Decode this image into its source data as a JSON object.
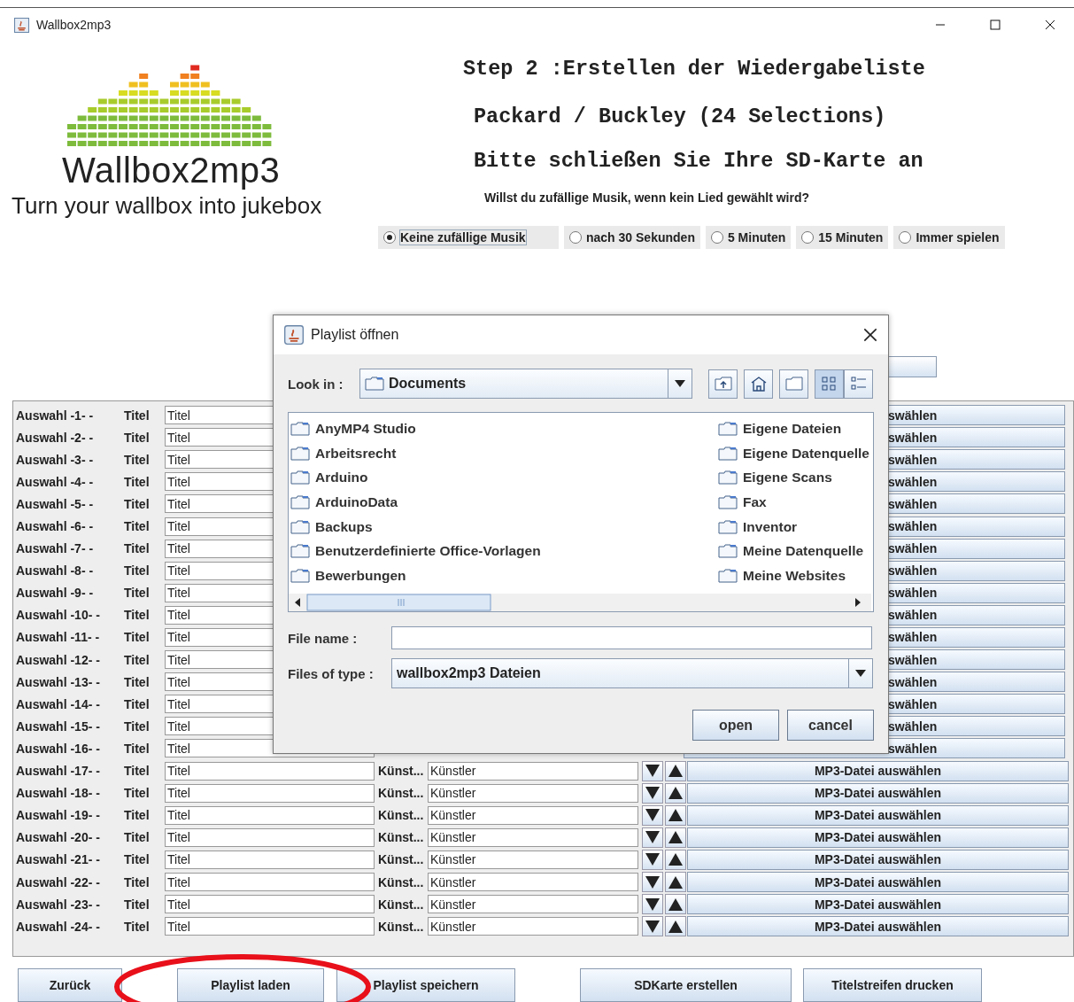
{
  "window": {
    "title": "Wallbox2mp3"
  },
  "logo": {
    "name": "Wallbox2mp3",
    "tagline": "Turn your wallbox into jukebox"
  },
  "headings": [
    "Step 2 :Erstellen der Wiedergabeliste",
    "Packard / Buckley (24 Selections)",
    "Bitte schließen Sie Ihre SD-Karte an"
  ],
  "random_question": "Willst du zufällige Musik, wenn kein Lied gewählt wird?",
  "random_options": [
    {
      "label": "Keine zufällige Musik",
      "selected": true
    },
    {
      "label": "nach 30 Sekunden",
      "selected": false
    },
    {
      "label": "5 Minuten",
      "selected": false
    },
    {
      "label": "15 Minuten",
      "selected": false
    },
    {
      "label": "Immer spielen",
      "selected": false
    }
  ],
  "rows": [
    {
      "kind": "covered",
      "label": "Auswahl -1- -",
      "title_label": "Titel",
      "title": "Titel",
      "button": "swählen"
    },
    {
      "kind": "covered",
      "label": "Auswahl -2- -",
      "title_label": "Titel",
      "title": "Titel",
      "button": "swählen"
    },
    {
      "kind": "covered",
      "label": "Auswahl -3- -",
      "title_label": "Titel",
      "title": "Titel",
      "button": "swählen"
    },
    {
      "kind": "covered",
      "label": "Auswahl -4- -",
      "title_label": "Titel",
      "title": "Titel",
      "button": "swählen"
    },
    {
      "kind": "covered",
      "label": "Auswahl -5- -",
      "title_label": "Titel",
      "title": "Titel",
      "button": "swählen"
    },
    {
      "kind": "covered",
      "label": "Auswahl -6- -",
      "title_label": "Titel",
      "title": "Titel",
      "button": "swählen"
    },
    {
      "kind": "covered",
      "label": "Auswahl -7- -",
      "title_label": "Titel",
      "title": "Titel",
      "button": "swählen"
    },
    {
      "kind": "covered",
      "label": "Auswahl -8- -",
      "title_label": "Titel",
      "title": "Titel",
      "button": "swählen"
    },
    {
      "kind": "covered",
      "label": "Auswahl -9- -",
      "title_label": "Titel",
      "title": "Titel",
      "button": "swählen"
    },
    {
      "kind": "covered",
      "label": "Auswahl -10- -",
      "title_label": "Titel",
      "title": "Titel",
      "button": "swählen"
    },
    {
      "kind": "covered",
      "label": "Auswahl -11- -",
      "title_label": "Titel",
      "title": "Titel",
      "button": "swählen"
    },
    {
      "kind": "covered",
      "label": "Auswahl -12- -",
      "title_label": "Titel",
      "title": "Titel",
      "button": "swählen"
    },
    {
      "kind": "covered",
      "label": "Auswahl -13- -",
      "title_label": "Titel",
      "title": "Titel",
      "button": "swählen"
    },
    {
      "kind": "covered",
      "label": "Auswahl -14- -",
      "title_label": "Titel",
      "title": "Titel",
      "button": "swählen"
    },
    {
      "kind": "covered",
      "label": "Auswahl -15- -",
      "title_label": "Titel",
      "title": "Titel",
      "button": "swählen"
    },
    {
      "kind": "covered",
      "label": "Auswahl -16- -",
      "title_label": "Titel",
      "title": "Titel",
      "button": "swählen"
    },
    {
      "kind": "full",
      "label": "Auswahl -17- -",
      "title_label": "Titel",
      "title": "Titel",
      "artist_label": "Künst...",
      "artist": "Künstler",
      "button": "MP3-Datei auswählen"
    },
    {
      "kind": "full",
      "label": "Auswahl -18- -",
      "title_label": "Titel",
      "title": "Titel",
      "artist_label": "Künst...",
      "artist": "Künstler",
      "button": "MP3-Datei auswählen"
    },
    {
      "kind": "full",
      "label": "Auswahl -19- -",
      "title_label": "Titel",
      "title": "Titel",
      "artist_label": "Künst...",
      "artist": "Künstler",
      "button": "MP3-Datei auswählen"
    },
    {
      "kind": "full",
      "label": "Auswahl -20- -",
      "title_label": "Titel",
      "title": "Titel",
      "artist_label": "Künst...",
      "artist": "Künstler",
      "button": "MP3-Datei auswählen"
    },
    {
      "kind": "full",
      "label": "Auswahl -21- -",
      "title_label": "Titel",
      "title": "Titel",
      "artist_label": "Künst...",
      "artist": "Künstler",
      "button": "MP3-Datei auswählen"
    },
    {
      "kind": "full",
      "label": "Auswahl -22- -",
      "title_label": "Titel",
      "title": "Titel",
      "artist_label": "Künst...",
      "artist": "Künstler",
      "button": "MP3-Datei auswählen"
    },
    {
      "kind": "full",
      "label": "Auswahl -23- -",
      "title_label": "Titel",
      "title": "Titel",
      "artist_label": "Künst...",
      "artist": "Künstler",
      "button": "MP3-Datei auswählen"
    },
    {
      "kind": "full",
      "label": "Auswahl -24- -",
      "title_label": "Titel",
      "title": "Titel",
      "artist_label": "Künst...",
      "artist": "Künstler",
      "button": "MP3-Datei auswählen"
    }
  ],
  "bottom_buttons": [
    {
      "label": "Zurück",
      "highlighted": false
    },
    {
      "label": "Playlist laden",
      "highlighted": true
    },
    {
      "label": "Playlist speichern",
      "highlighted": false
    },
    {
      "label": "SDKarte erstellen",
      "highlighted": false
    },
    {
      "label": "Titelstreifen drucken",
      "highlighted": false
    }
  ],
  "dialog": {
    "title": "Playlist öffnen",
    "look_in_label": "Look in :",
    "look_in": "Documents",
    "tools": [
      {
        "kind": "up",
        "selected": false
      },
      {
        "kind": "home",
        "selected": false
      },
      {
        "kind": "new-folder",
        "selected": false
      },
      {
        "kind": "list",
        "selected": true
      },
      {
        "kind": "details",
        "selected": false
      }
    ],
    "folders_left": [
      "AnyMP4 Studio",
      "Arbeitsrecht",
      "Arduino",
      "ArduinoData",
      "Backups",
      "Benutzerdefinierte Office-Vorlagen",
      "Bewerbungen"
    ],
    "folders_right": [
      "Eigene Dateien",
      "Eigene Datenquelle",
      "Eigene Scans",
      "Fax",
      "Inventor",
      "Meine Datenquelle",
      "Meine Websites"
    ],
    "file_name_label": "File name :",
    "file_type_label": "Files of type :",
    "file_type": "wallbox2mp3 Dateien",
    "buttons": [
      "open",
      "cancel"
    ]
  }
}
